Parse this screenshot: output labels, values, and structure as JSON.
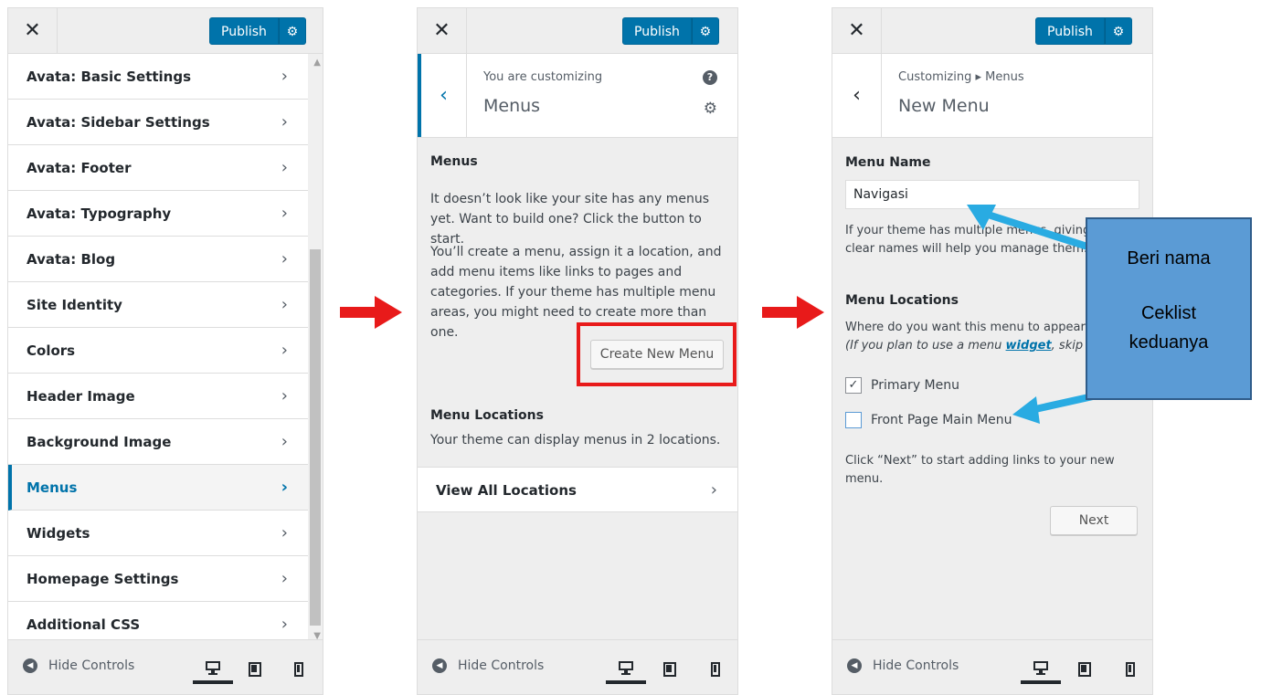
{
  "common": {
    "publish_label": "Publish",
    "hide_controls_label": "Hide Controls"
  },
  "panel1": {
    "items": [
      {
        "label": "Avata: Basic Settings"
      },
      {
        "label": "Avata: Sidebar Settings"
      },
      {
        "label": "Avata: Footer"
      },
      {
        "label": "Avata: Typography"
      },
      {
        "label": "Avata: Blog"
      },
      {
        "label": "Site Identity"
      },
      {
        "label": "Colors"
      },
      {
        "label": "Header Image"
      },
      {
        "label": "Background Image"
      },
      {
        "label": "Menus"
      },
      {
        "label": "Widgets"
      },
      {
        "label": "Homepage Settings"
      },
      {
        "label": "Additional CSS"
      }
    ],
    "active_item": "Menus"
  },
  "panel2": {
    "customizing_label": "You are customizing",
    "title": "Menus",
    "menus_heading": "Menus",
    "para1": "It doesn’t look like your site has any menus yet. Want to build one? Click the button to start.",
    "para2": "You’ll create a menu, assign it a location, and add menu items like links to pages and categories. If your theme has multiple menu areas, you might need to create more than one.",
    "create_button": "Create New Menu",
    "locations_heading": "Menu Locations",
    "locations_text": "Your theme can display menus in 2 locations.",
    "view_all": "View All Locations"
  },
  "panel3": {
    "breadcrumb": "Customizing ▸ Menus",
    "title": "New Menu",
    "menu_name_heading": "Menu Name",
    "menu_name_value": "Navigasi",
    "name_help": "If your theme has multiple menus, giving them clear names will help you manage them.",
    "locations_heading": "Menu Locations",
    "where_text": "Where do you want this menu to appear?",
    "italic_prefix": "(If you plan to use a menu ",
    "italic_link": "widget",
    "italic_suffix": ", skip this step.)",
    "primary_menu": "Primary Menu",
    "primary_checked": true,
    "front_page_menu": "Front Page Main Menu",
    "front_checked": false,
    "next_help": "Click “Next” to start adding links to your new menu.",
    "next_button": "Next"
  },
  "annotation": {
    "line1": "Beri nama",
    "line2": "Ceklist",
    "line3": "keduanya",
    "box_color": "#5b9bd5",
    "arrow_color": "#29abe2",
    "red_color": "#e81a1a",
    "accent": "#0073aa"
  }
}
